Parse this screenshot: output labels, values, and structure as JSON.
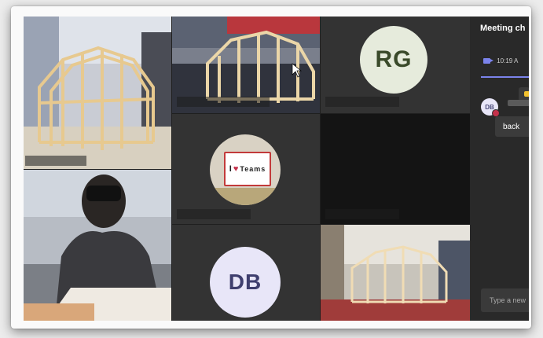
{
  "chat": {
    "title": "Meeting ch",
    "meeting_time": "10:19 A",
    "sender_initials": "DB",
    "message": "back",
    "compose_placeholder": "Type a new"
  },
  "participants": [
    {
      "tile": "video-top-left",
      "initials": "",
      "name": ""
    },
    {
      "tile": "video-top-center",
      "initials": "",
      "name": ""
    },
    {
      "tile": "avatar-tile",
      "initials": "RG",
      "name": ""
    },
    {
      "tile": "video-student",
      "initials": "",
      "name": ""
    },
    {
      "tile": "teams-logo-tile",
      "initials": "",
      "name": ""
    },
    {
      "tile": "dark-video",
      "initials": "",
      "name": ""
    },
    {
      "tile": "avatar-tile",
      "initials": "DB",
      "name": ""
    },
    {
      "tile": "video-bottom-right",
      "initials": "",
      "name": ""
    }
  ],
  "teams_logo": {
    "line1": "I",
    "heart": "♥",
    "line2": "Teams"
  },
  "colors": {
    "background": "#1f1f1f",
    "tile": "#292929",
    "accent": "#7b83eb",
    "rg_avatar": "#e6ebdc",
    "rg_text": "#3a4a2a",
    "db_avatar": "#e8e6f8",
    "db_text": "#3e3e6e",
    "status_red": "#c4314b"
  }
}
